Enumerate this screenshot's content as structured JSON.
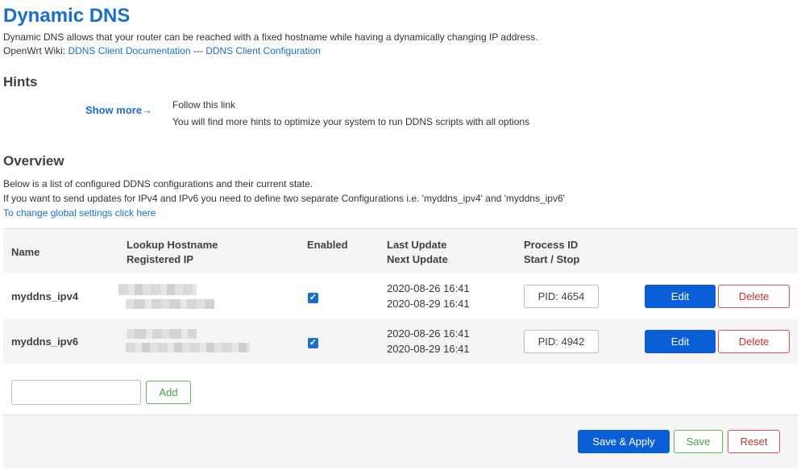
{
  "header": {
    "title": "Dynamic DNS",
    "description": "Dynamic DNS allows that your router can be reached with a fixed hostname while having a dynamically changing IP address.",
    "wiki_prefix": "OpenWrt Wiki: ",
    "wiki_link1": "DDNS Client Documentation",
    "wiki_sep": " --- ",
    "wiki_link2": "DDNS Client Configuration"
  },
  "hints": {
    "heading": "Hints",
    "show_more": "Show more→",
    "line1": "Follow this link",
    "line2": "You will find more hints to optimize your system to run DDNS scripts with all options"
  },
  "overview": {
    "heading": "Overview",
    "line1": "Below is a list of configured DDNS configurations and their current state.",
    "line2": "If you want to send updates for IPv4 and IPv6 you need to define two separate Configurations i.e. 'myddns_ipv4' and 'myddns_ipv6'",
    "link": "To change global settings click here"
  },
  "table": {
    "headers": {
      "name": "Name",
      "lookup": "Lookup Hostname",
      "registered": "Registered IP",
      "enabled": "Enabled",
      "last_update": "Last Update",
      "next_update": "Next Update",
      "process_id": "Process ID",
      "start_stop": "Start / Stop"
    },
    "rows": [
      {
        "name": "myddns_ipv4",
        "enabled": true,
        "last_update": "2020-08-26 16:41",
        "next_update": "2020-08-29 16:41",
        "pid_label": "PID: 4654",
        "edit_label": "Edit",
        "delete_label": "Delete"
      },
      {
        "name": "myddns_ipv6",
        "enabled": true,
        "last_update": "2020-08-26 16:41",
        "next_update": "2020-08-29 16:41",
        "pid_label": "PID: 4942",
        "edit_label": "Edit",
        "delete_label": "Delete"
      }
    ]
  },
  "add": {
    "input_value": "",
    "button_label": "Add"
  },
  "footer": {
    "save_apply_label": "Save & Apply",
    "save_label": "Save",
    "reset_label": "Reset"
  },
  "colors": {
    "accent": "#1b6fc7",
    "primary_button": "#0a5fd6",
    "delete": "#d9534f",
    "save": "#5cb85c"
  },
  "icons": {
    "checkbox": "checkbox-checked-icon"
  }
}
